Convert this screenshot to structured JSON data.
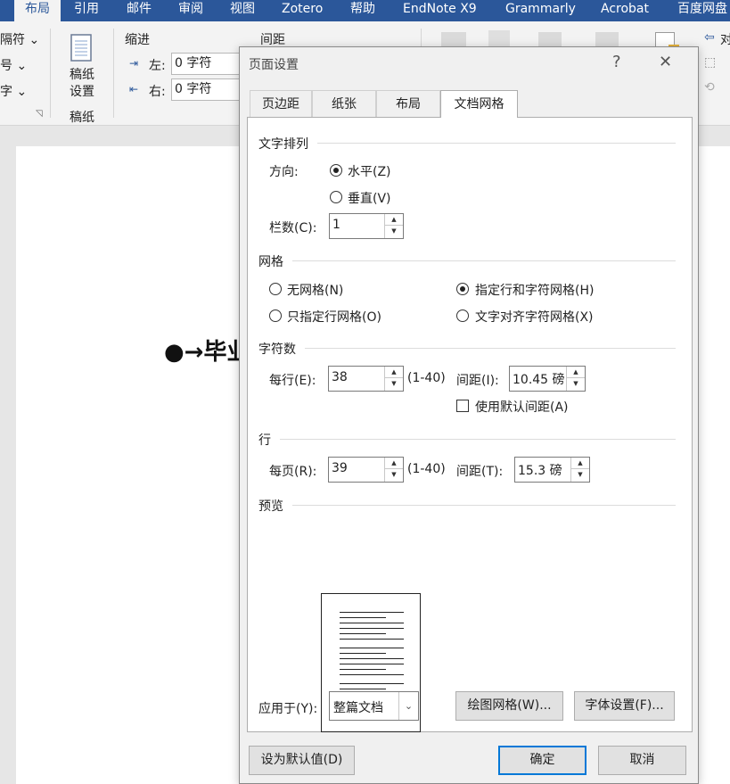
{
  "ribbon_tabs": [
    "布局",
    "引用",
    "邮件",
    "审阅",
    "视图",
    "Zotero",
    "帮助",
    "EndNote X9",
    "Grammarly",
    "Acrobat",
    "百度网盘"
  ],
  "ribbon": {
    "partial_left_items": [
      "隔符 ⌄",
      "号 ⌄",
      "字 ⌄"
    ],
    "manuscript_button": "稿纸\n设置",
    "manuscript_group_label": "稿纸",
    "indent_label": "缩进",
    "indent_left_label": "左:",
    "indent_left_value": "0 字符",
    "indent_right_label": "右:",
    "indent_right_value": "0 字符",
    "spacing_label": "间距",
    "partial_right_label": "对"
  },
  "document": {
    "heading_visible": "●→毕业"
  },
  "dialog": {
    "title": "页面设置",
    "help": "?",
    "close": "✕",
    "tabs": [
      "页边距",
      "纸张",
      "布局",
      "文档网格"
    ],
    "active_tab": 3,
    "text_direction": {
      "section": "文字排列",
      "direction_label": "方向:",
      "horizontal": "水平(Z)",
      "vertical": "垂直(V)",
      "selected": "horizontal",
      "columns_label": "栏数(C):",
      "columns_value": "1"
    },
    "grid": {
      "section": "网格",
      "options": [
        "无网格(N)",
        "指定行和字符网格(H)",
        "只指定行网格(O)",
        "文字对齐字符网格(X)"
      ],
      "selected_index": 1
    },
    "characters": {
      "section": "字符数",
      "per_line_label": "每行(E):",
      "per_line_value": "38",
      "per_line_range": "(1-40)",
      "pitch_label": "间距(I):",
      "pitch_value": "10.45 磅",
      "use_default_label": "使用默认间距(A)",
      "use_default_checked": false
    },
    "lines": {
      "section": "行",
      "per_page_label": "每页(R):",
      "per_page_value": "39",
      "per_page_range": "(1-40)",
      "pitch_label": "间距(T):",
      "pitch_value": "15.3 磅"
    },
    "preview": {
      "section": "预览",
      "line_groups": [
        6,
        6,
        6
      ]
    },
    "apply_to_label": "应用于(Y):",
    "apply_to_value": "整篇文档",
    "draw_grid_button": "绘图网格(W)...",
    "font_settings_button": "字体设置(F)...",
    "set_default_button": "设为默认值(D)",
    "ok_button": "确定",
    "cancel_button": "取消"
  },
  "colors": {
    "tabbar": "#2b579a",
    "dialog_bg": "#f0f0f0",
    "focus_border": "#0078d7"
  }
}
